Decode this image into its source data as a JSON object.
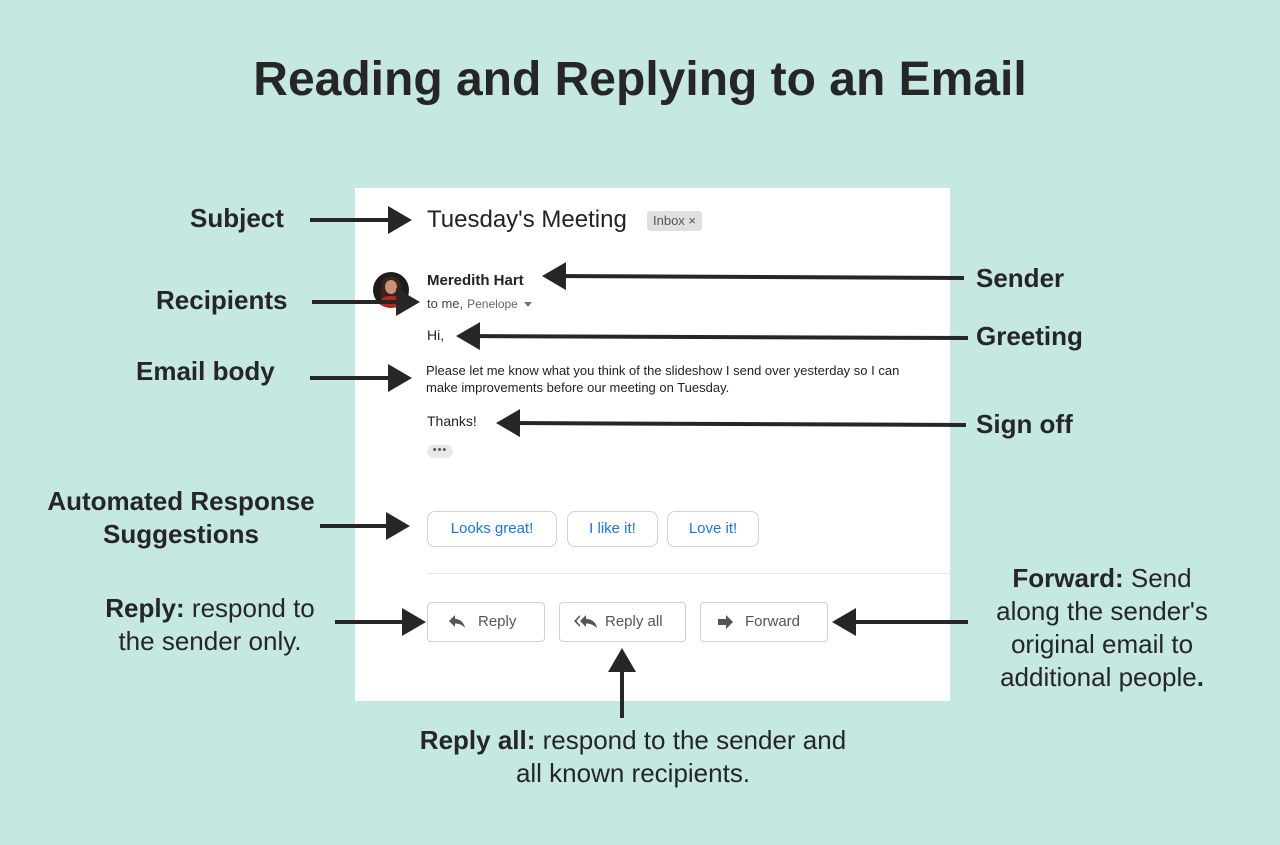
{
  "title": "Reading and Replying to an Email",
  "email": {
    "subject": "Tuesday's Meeting",
    "label_badge": "Inbox ×",
    "sender": "Meredith Hart",
    "to_prefix": "to me,",
    "to_cc": "Penelope",
    "greeting": "Hi,",
    "body": "Please let me know what you think of the slideshow I send over yesterday so I can make improvements before our meeting on Tuesday.",
    "signoff": "Thanks!",
    "more_indicator": "•••",
    "suggestions": [
      "Looks great!",
      "I like it!",
      "Love it!"
    ],
    "actions": {
      "reply": "Reply",
      "reply_all": "Reply all",
      "forward": "Forward"
    }
  },
  "labels": {
    "subject": "Subject",
    "recipients": "Recipients",
    "email_body": "Email body",
    "sender": "Sender",
    "greeting": "Greeting",
    "sign_off": "Sign off",
    "suggestions_line1": "Automated Response",
    "suggestions_line2": "Suggestions"
  },
  "notes": {
    "reply_term": "Reply:",
    "reply_desc_1": "respond to",
    "reply_desc_2": "the sender only.",
    "reply_all_term": "Reply all:",
    "reply_all_desc_1": "respond to the sender and",
    "reply_all_desc_2": "all known recipients.",
    "forward_term": "Forward:",
    "forward_desc_1": "Send",
    "forward_desc_2": "along the sender's",
    "forward_desc_3": "original email to",
    "forward_desc_4": "additional people",
    "forward_end": "."
  },
  "colors": {
    "background": "#c5e8e3",
    "card": "#ffffff",
    "link_blue": "#1a73e8",
    "arrow": "#262626"
  }
}
